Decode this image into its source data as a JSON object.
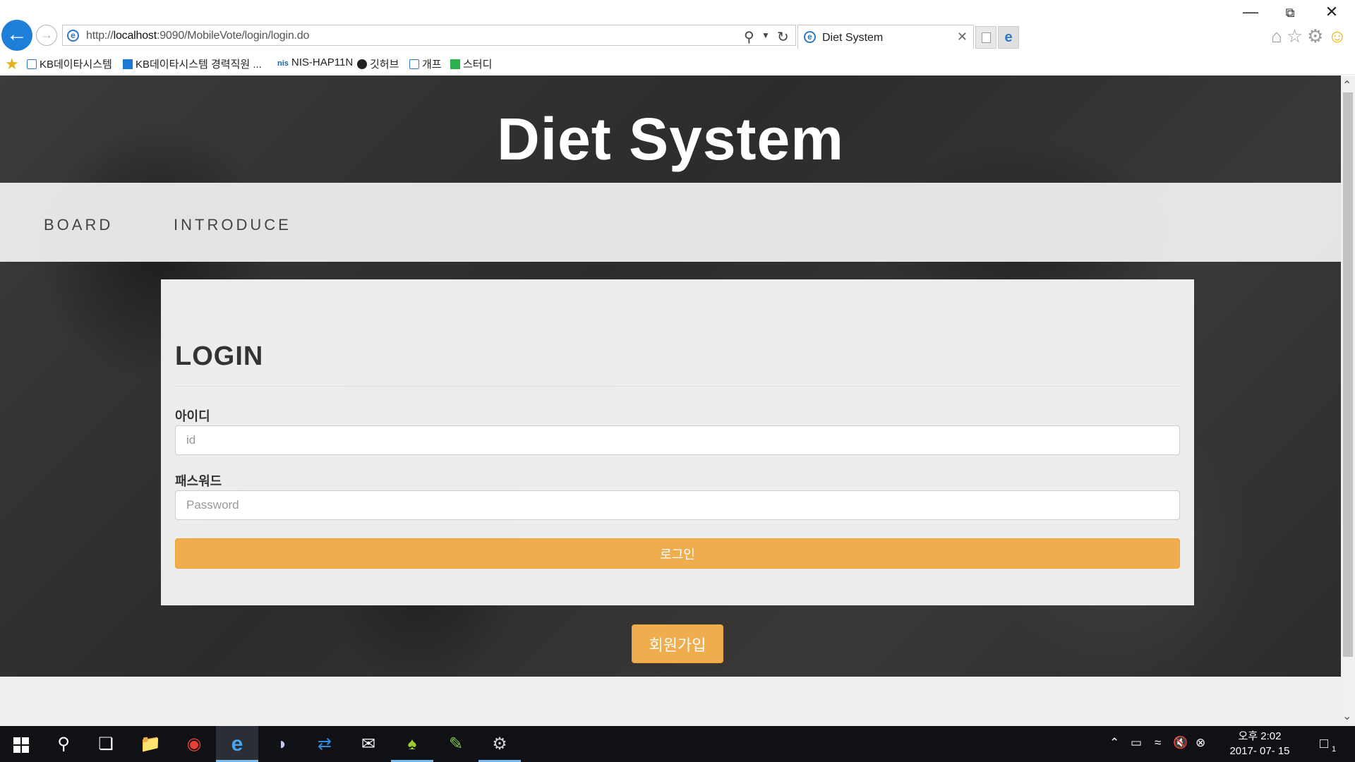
{
  "browser": {
    "url_prefix": "http://",
    "url_host": "localhost",
    "url_rest": ":9090/MobileVote/login/login.do",
    "tab_title": "Diet System",
    "tab_close": "✕",
    "favorites": [
      {
        "label": "KB데이타시스템"
      },
      {
        "label": "KB데이타시스템 경력직원 ..."
      },
      {
        "label": "NIS-HAP11N"
      },
      {
        "label": "깃허브"
      },
      {
        "label": "개프"
      },
      {
        "label": "스터디"
      }
    ],
    "fav_nis_badge": "nis"
  },
  "page": {
    "site_title": "Diet System",
    "nav": {
      "board": "BOARD",
      "introduce": "INTRODUCE"
    },
    "login": {
      "heading": "LOGIN",
      "id_label": "아이디",
      "id_placeholder": "id",
      "pw_label": "패스워드",
      "pw_placeholder": "Password",
      "submit_label": "로그인"
    },
    "signup_label": "회원가입"
  },
  "taskbar": {
    "clock_time": "오후 2:02",
    "clock_date": "2017- 07- 15",
    "notification_count": "1"
  },
  "colors": {
    "accent": "#f0ad4e",
    "ie_blue": "#1e7fd8"
  }
}
